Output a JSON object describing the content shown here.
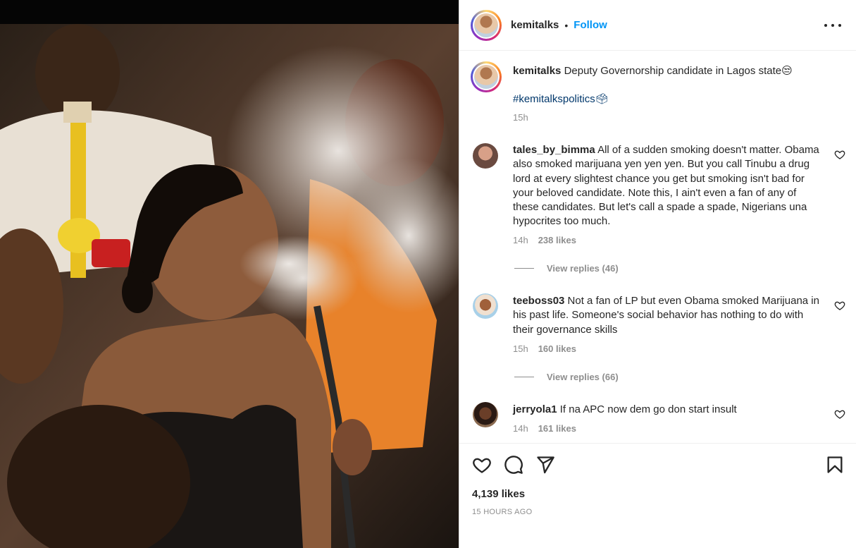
{
  "post": {
    "username": "kemitalks",
    "separator": "•",
    "follow_label": "Follow",
    "caption": "Deputy Governorship candidate in Lagos state😒",
    "hashtag": "#kemitalkspolitics🗳",
    "caption_time": "15h",
    "likes": "4,139 likes",
    "posted": "15 HOURS AGO"
  },
  "comments": [
    {
      "username": "tales_by_bimma",
      "text": "All of a sudden smoking doesn't matter. Obama also smoked marijuana yen yen yen. But you call Tinubu a drug lord at every slightest chance you get but smoking isn't bad for your beloved candidate. Note this, I ain't even a fan of any of these candidates. But let's call a spade a spade, Nigerians una hypocrites too much.",
      "time": "14h",
      "likes": "238 likes",
      "replies": "View replies (46)"
    },
    {
      "username": "teeboss03",
      "text": "Not a fan of LP but even Obama smoked Marijuana in his past life. Someone's social behavior has nothing to do with their governance skills",
      "time": "15h",
      "likes": "160 likes",
      "replies": "View replies (66)"
    },
    {
      "username": "jerryola1",
      "text": "If na APC now dem go don start insult",
      "time": "14h",
      "likes": "161 likes"
    }
  ],
  "icons": {
    "like": "heart-icon",
    "comment": "comment-icon",
    "share": "paper-plane-icon",
    "save": "bookmark-icon",
    "more": "more-options-icon"
  },
  "colors": {
    "link": "#0095f6",
    "hashtag": "#00376b",
    "muted": "#8e8e8e"
  }
}
